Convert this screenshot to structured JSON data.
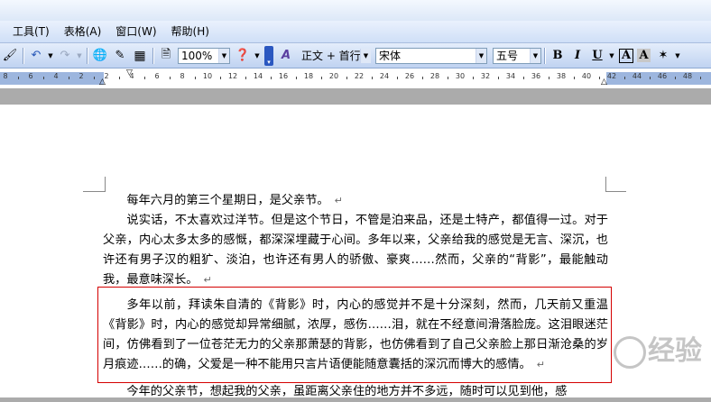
{
  "menubar": {
    "items": [
      "工具(T)",
      "表格(A)",
      "窗口(W)",
      "帮助(H)"
    ]
  },
  "toolbar": {
    "zoom": "100%",
    "style": "正文 + 首行",
    "font": "宋体",
    "font_size": "五号",
    "bold": "B",
    "italic": "I",
    "underline": "U",
    "char_border": "A",
    "char_shading": "A",
    "style_icon": "A"
  },
  "ruler": {
    "labels": [
      "8",
      "6",
      "4",
      "2",
      "2",
      "4",
      "6",
      "8",
      "10",
      "12",
      "14",
      "16",
      "18",
      "20",
      "22",
      "24",
      "26",
      "28",
      "30",
      "32",
      "34",
      "36",
      "38",
      "40",
      "42",
      "44",
      "46",
      "48"
    ]
  },
  "document": {
    "paragraphs": [
      "每年六月的第三个星期日，是父亲节。",
      "说实话，不太喜欢过洋节。但是这个节日，不管是泊来品，还是土特产，都值得一过。对于父亲，内心太多太多的感慨，都深深埋藏于心间。多年以来，父亲给我的感觉是无言、深沉，也许还有男子汉的粗犷、淡泊，也许还有男人的骄傲、豪爽……然而，父亲的“背影”，最能触动我，最意味深长。",
      "多年以前，拜读朱自清的《背影》时，内心的感觉并不是十分深刻，然而，几天前又重温《背影》时，内心的感觉却异常细腻，浓厚，感伤……泪，就在不经意间滑落脸庞。这泪眼迷茫间，仿佛看到了一位苍茫无力的父亲那萧瑟的背影，也仿佛看到了自己父亲脸上那日渐沧桑的岁月痕迹……的确，父爱是一种不能用只言片语便能随意囊括的深沉而博大的感情。",
      "今年的父亲节，想起我的父亲，虽距离父亲住的地方并不多远，随时可以见到他，感"
    ],
    "paragraph_mark": "↵"
  },
  "watermark": "经验"
}
